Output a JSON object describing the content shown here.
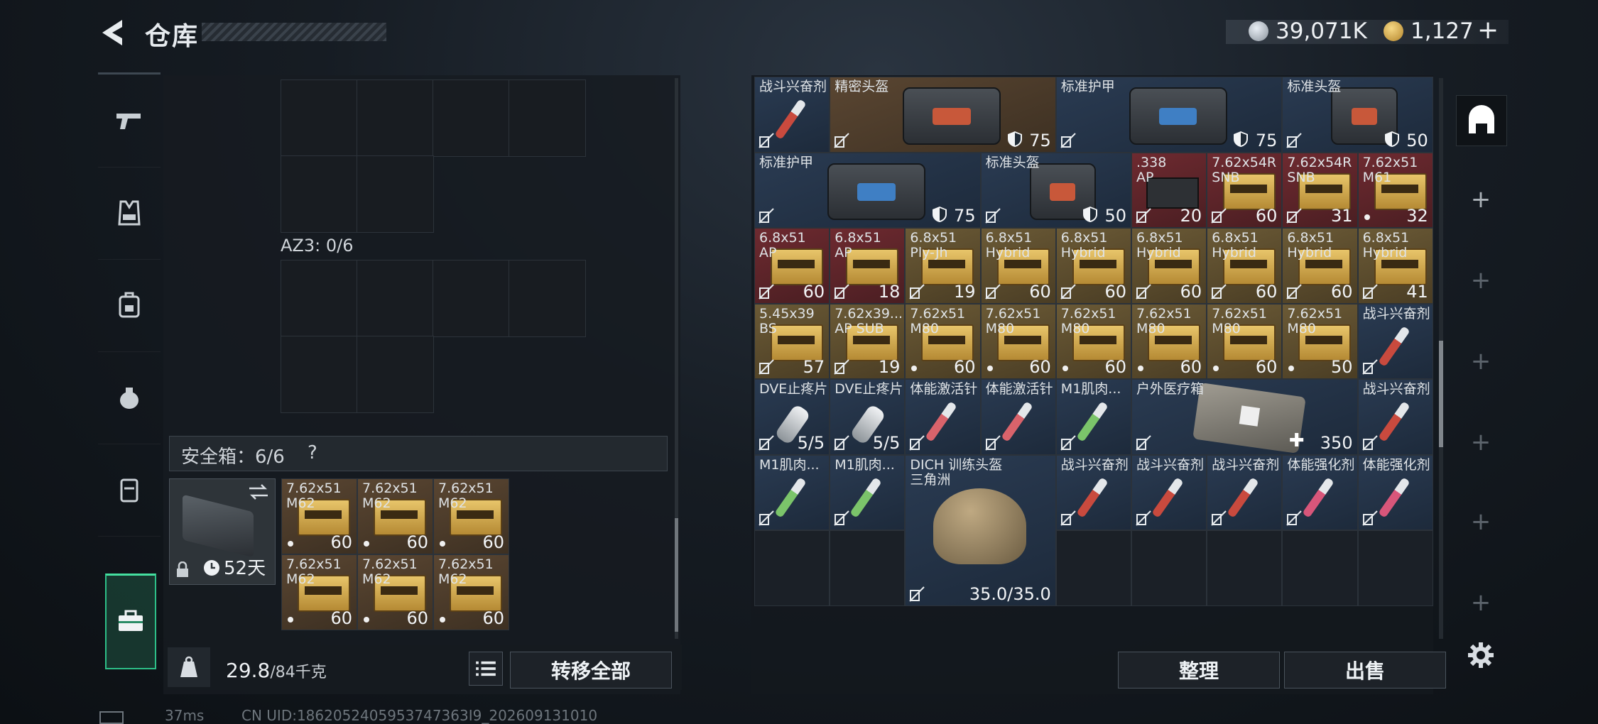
{
  "header": {
    "title": "仓库"
  },
  "currency": {
    "coins": "39,071K",
    "tickets": "1,127",
    "tickets_add": "+"
  },
  "left_panel": {
    "container_label": "AZ3: 0/6",
    "safebox_label": "安全箱：6/6",
    "safebox_help": "?",
    "safebox_days": "52天",
    "safebox_items": [
      {
        "name": "7.62x51\nM62",
        "count": "60"
      },
      {
        "name": "7.62x51\nM62",
        "count": "60"
      },
      {
        "name": "7.62x51\nM62",
        "count": "60"
      },
      {
        "name": "7.62x51\nM62",
        "count": "60"
      },
      {
        "name": "7.62x51\nM62",
        "count": "60"
      },
      {
        "name": "7.62x51\nM62",
        "count": "60"
      }
    ],
    "weight_value": "29.8",
    "weight_max": "/84千克",
    "transfer_all": "转移全部"
  },
  "stash": {
    "items": [
      {
        "name": "战斗兴奋剂",
        "count": "",
        "kind": "syringe",
        "bg": "blue",
        "syr": "#c94a3e"
      },
      {
        "name": "精密头盔",
        "count": "75",
        "kind": "bag",
        "bg": "brown",
        "shield": true,
        "win": "#c8583a"
      },
      {
        "name": "标准护甲",
        "count": "75",
        "kind": "bag",
        "bg": "blue",
        "shield": true,
        "win": "#3f7fc4"
      },
      {
        "name": "标准头盔",
        "count": "50",
        "kind": "bag",
        "bg": "blue",
        "shield": true,
        "win": "#c8583a"
      },
      {
        "name": "标准护甲",
        "count": "75",
        "kind": "bag",
        "bg": "blue",
        "shield": true,
        "win": "#3f7fc4"
      },
      {
        "name": "标准头盔",
        "count": "50",
        "kind": "bag",
        "bg": "blue",
        "shield": true,
        "win": "#c8583a"
      },
      {
        "name": ".338\nAP",
        "count": "20",
        "kind": "case",
        "bg": "red"
      },
      {
        "name": "7.62x54R\nSNB",
        "count": "60",
        "kind": "ammo",
        "bg": "red"
      },
      {
        "name": "7.62x54R\nSNB",
        "count": "31",
        "kind": "ammo",
        "bg": "red"
      },
      {
        "name": "7.62x51\nM61",
        "count": "32",
        "kind": "ammo",
        "bg": "red",
        "dot": true
      },
      {
        "name": "6.8x51\nAP",
        "count": "60",
        "kind": "ammo",
        "bg": "red"
      },
      {
        "name": "6.8x51\nAP",
        "count": "18",
        "kind": "ammo",
        "bg": "red"
      },
      {
        "name": "6.8x51\nPly-Jh",
        "count": "19",
        "kind": "ammo",
        "bg": "gold"
      },
      {
        "name": "6.8x51\nHybrid",
        "count": "60",
        "kind": "ammo",
        "bg": "gold"
      },
      {
        "name": "6.8x51\nHybrid",
        "count": "60",
        "kind": "ammo",
        "bg": "gold"
      },
      {
        "name": "6.8x51\nHybrid",
        "count": "60",
        "kind": "ammo",
        "bg": "gold"
      },
      {
        "name": "6.8x51\nHybrid",
        "count": "60",
        "kind": "ammo",
        "bg": "gold"
      },
      {
        "name": "6.8x51\nHybrid",
        "count": "60",
        "kind": "ammo",
        "bg": "gold"
      },
      {
        "name": "6.8x51\nHybrid",
        "count": "41",
        "kind": "ammo",
        "bg": "gold"
      },
      {
        "name": "5.45x39\nBS",
        "count": "57",
        "kind": "ammo",
        "bg": "gold"
      },
      {
        "name": "7.62x39...\nAP SUB",
        "count": "19",
        "kind": "ammo",
        "bg": "gold"
      },
      {
        "name": "7.62x51\nM80",
        "count": "60",
        "kind": "ammo",
        "bg": "gold",
        "dot": true
      },
      {
        "name": "7.62x51\nM80",
        "count": "60",
        "kind": "ammo",
        "bg": "gold",
        "dot": true
      },
      {
        "name": "7.62x51\nM80",
        "count": "60",
        "kind": "ammo",
        "bg": "gold",
        "dot": true
      },
      {
        "name": "7.62x51\nM80",
        "count": "60",
        "kind": "ammo",
        "bg": "gold",
        "dot": true
      },
      {
        "name": "7.62x51\nM80",
        "count": "60",
        "kind": "ammo",
        "bg": "gold",
        "dot": true
      },
      {
        "name": "7.62x51\nM80",
        "count": "50",
        "kind": "ammo",
        "bg": "gold",
        "dot": true
      },
      {
        "name": "战斗兴奋剂",
        "count": "",
        "kind": "syringe",
        "bg": "blue",
        "syr": "#c94a3e"
      },
      {
        "name": "DVE止疼片",
        "count": "5/5",
        "kind": "pills",
        "bg": "blue"
      },
      {
        "name": "DVE止疼片",
        "count": "5/5",
        "kind": "pills",
        "bg": "blue"
      },
      {
        "name": "体能激活针",
        "count": "",
        "kind": "syringe",
        "bg": "blue",
        "syr": "#d9636b"
      },
      {
        "name": "体能激活针",
        "count": "",
        "kind": "syringe",
        "bg": "blue",
        "syr": "#d9636b"
      },
      {
        "name": "M1肌肉...",
        "count": "",
        "kind": "syringe",
        "bg": "blue",
        "syr": "#7bc46a"
      },
      {
        "name": "户外医疗箱",
        "count": "350",
        "kind": "medkit",
        "bg": "blue"
      },
      {
        "name": "战斗兴奋剂",
        "count": "",
        "kind": "syringe",
        "bg": "blue",
        "syr": "#c94a3e"
      },
      {
        "name": "M1肌肉...",
        "count": "",
        "kind": "syringe",
        "bg": "blue",
        "syr": "#7bc46a"
      },
      {
        "name": "M1肌肉...",
        "count": "",
        "kind": "syringe",
        "bg": "blue",
        "syr": "#7bc46a"
      },
      {
        "name": "DICH 训练头盔\n三角洲",
        "count": "35.0/35.0",
        "kind": "helmet",
        "bg": "blue"
      },
      {
        "name": "战斗兴奋剂",
        "count": "",
        "kind": "syringe",
        "bg": "blue",
        "syr": "#c94a3e"
      },
      {
        "name": "战斗兴奋剂",
        "count": "",
        "kind": "syringe",
        "bg": "blue",
        "syr": "#c94a3e"
      },
      {
        "name": "战斗兴奋剂",
        "count": "",
        "kind": "syringe",
        "bg": "blue",
        "syr": "#c94a3e"
      },
      {
        "name": "体能强化剂",
        "count": "",
        "kind": "syringe",
        "bg": "blue",
        "syr": "#d8567a"
      },
      {
        "name": "体能强化剂",
        "count": "",
        "kind": "syringe",
        "bg": "blue",
        "syr": "#d8567a"
      }
    ],
    "sort_button": "整理",
    "sell_button": "出售"
  },
  "status_bar": {
    "ping": "37ms",
    "uid": "CN UID:1862052405953747363I9_202609131010"
  },
  "colors": {
    "accent_green": "#2dbf88",
    "rarity_red": "#6e2a30",
    "rarity_gold": "#6b5a36",
    "rarity_blue": "#2a3b52"
  }
}
